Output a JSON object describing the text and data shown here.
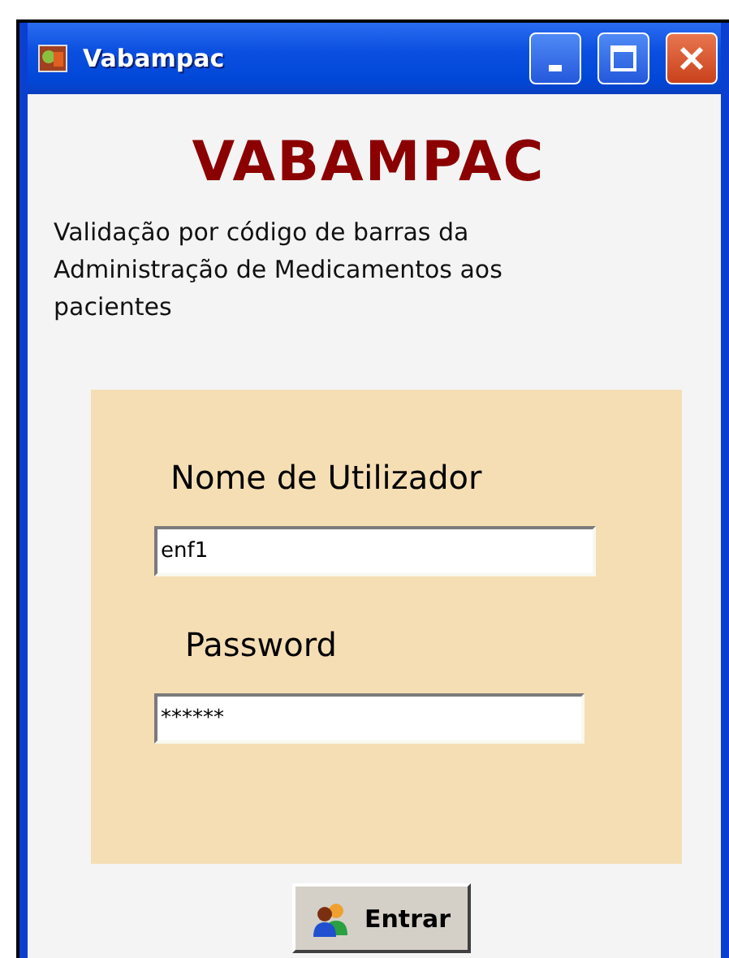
{
  "window": {
    "title": "Vabampac"
  },
  "logo": "VABAMPAC",
  "description": "Validação por código de barras da Administração de Medicamentos aos pacientes",
  "form": {
    "fields": [
      {
        "label": "Nome de Utilizador",
        "value": "enf1"
      },
      {
        "label": "Password",
        "value": "******"
      }
    ]
  },
  "buttons": [
    {
      "label": "Entrar"
    }
  ]
}
